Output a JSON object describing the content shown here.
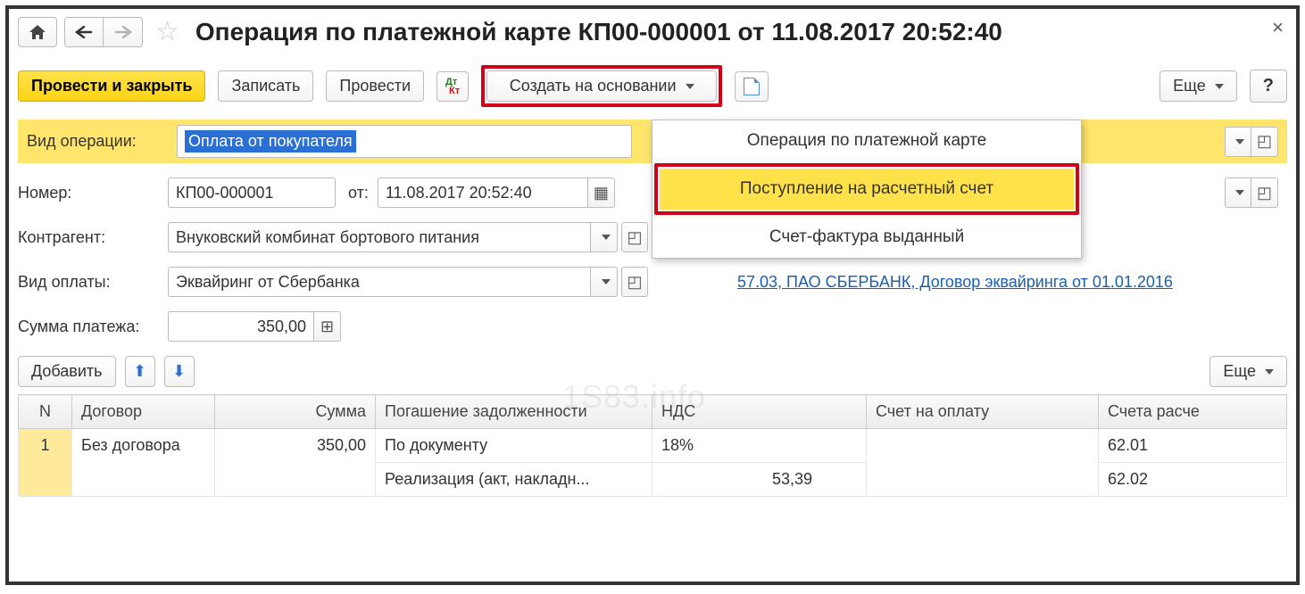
{
  "header": {
    "title": "Операция по платежной карте КП00-000001 от 11.08.2017 20:52:40"
  },
  "toolbar": {
    "post_and_close": "Провести и закрыть",
    "save": "Записать",
    "post": "Провести",
    "create_based_on": "Создать на основании",
    "more": "Еще",
    "help": "?"
  },
  "menu": {
    "item1": "Операция по платежной карте",
    "item2": "Поступление на расчетный счет",
    "item3": "Счет-фактура выданный"
  },
  "form": {
    "op_type_label": "Вид операции:",
    "op_type_value": "Оплата от покупателя",
    "number_label": "Номер:",
    "number_value": "КП00-000001",
    "date_label": "от:",
    "date_value": "11.08.2017 20:52:40",
    "counterparty_label": "Контрагент:",
    "counterparty_value": "Внуковский комбинат бортового питания",
    "payment_type_label": "Вид оплаты:",
    "payment_type_value": "Эквайринг от Сбербанка",
    "bank_link": "57.03, ПАО СБЕРБАНК, Договор эквайринга от 01.01.2016",
    "amount_label": "Сумма платежа:",
    "amount_value": "350,00"
  },
  "table_toolbar": {
    "add": "Добавить",
    "more": "Еще"
  },
  "table": {
    "cols": {
      "n": "N",
      "contract": "Договор",
      "sum": "Сумма",
      "repayment": "Погашение задолженности",
      "vat": "НДС",
      "invoice": "Счет на оплату",
      "accounts": "Счета расче"
    },
    "rows": [
      {
        "n": "1",
        "contract": "Без договора",
        "sum": "350,00",
        "repayment1": "По документу",
        "repayment2": "Реализация (акт, накладн...",
        "vat1": "18%",
        "vat2": "53,39",
        "invoice": "",
        "acc1": "62.01",
        "acc2": "62.02"
      }
    ]
  },
  "watermark": "1S83.info"
}
